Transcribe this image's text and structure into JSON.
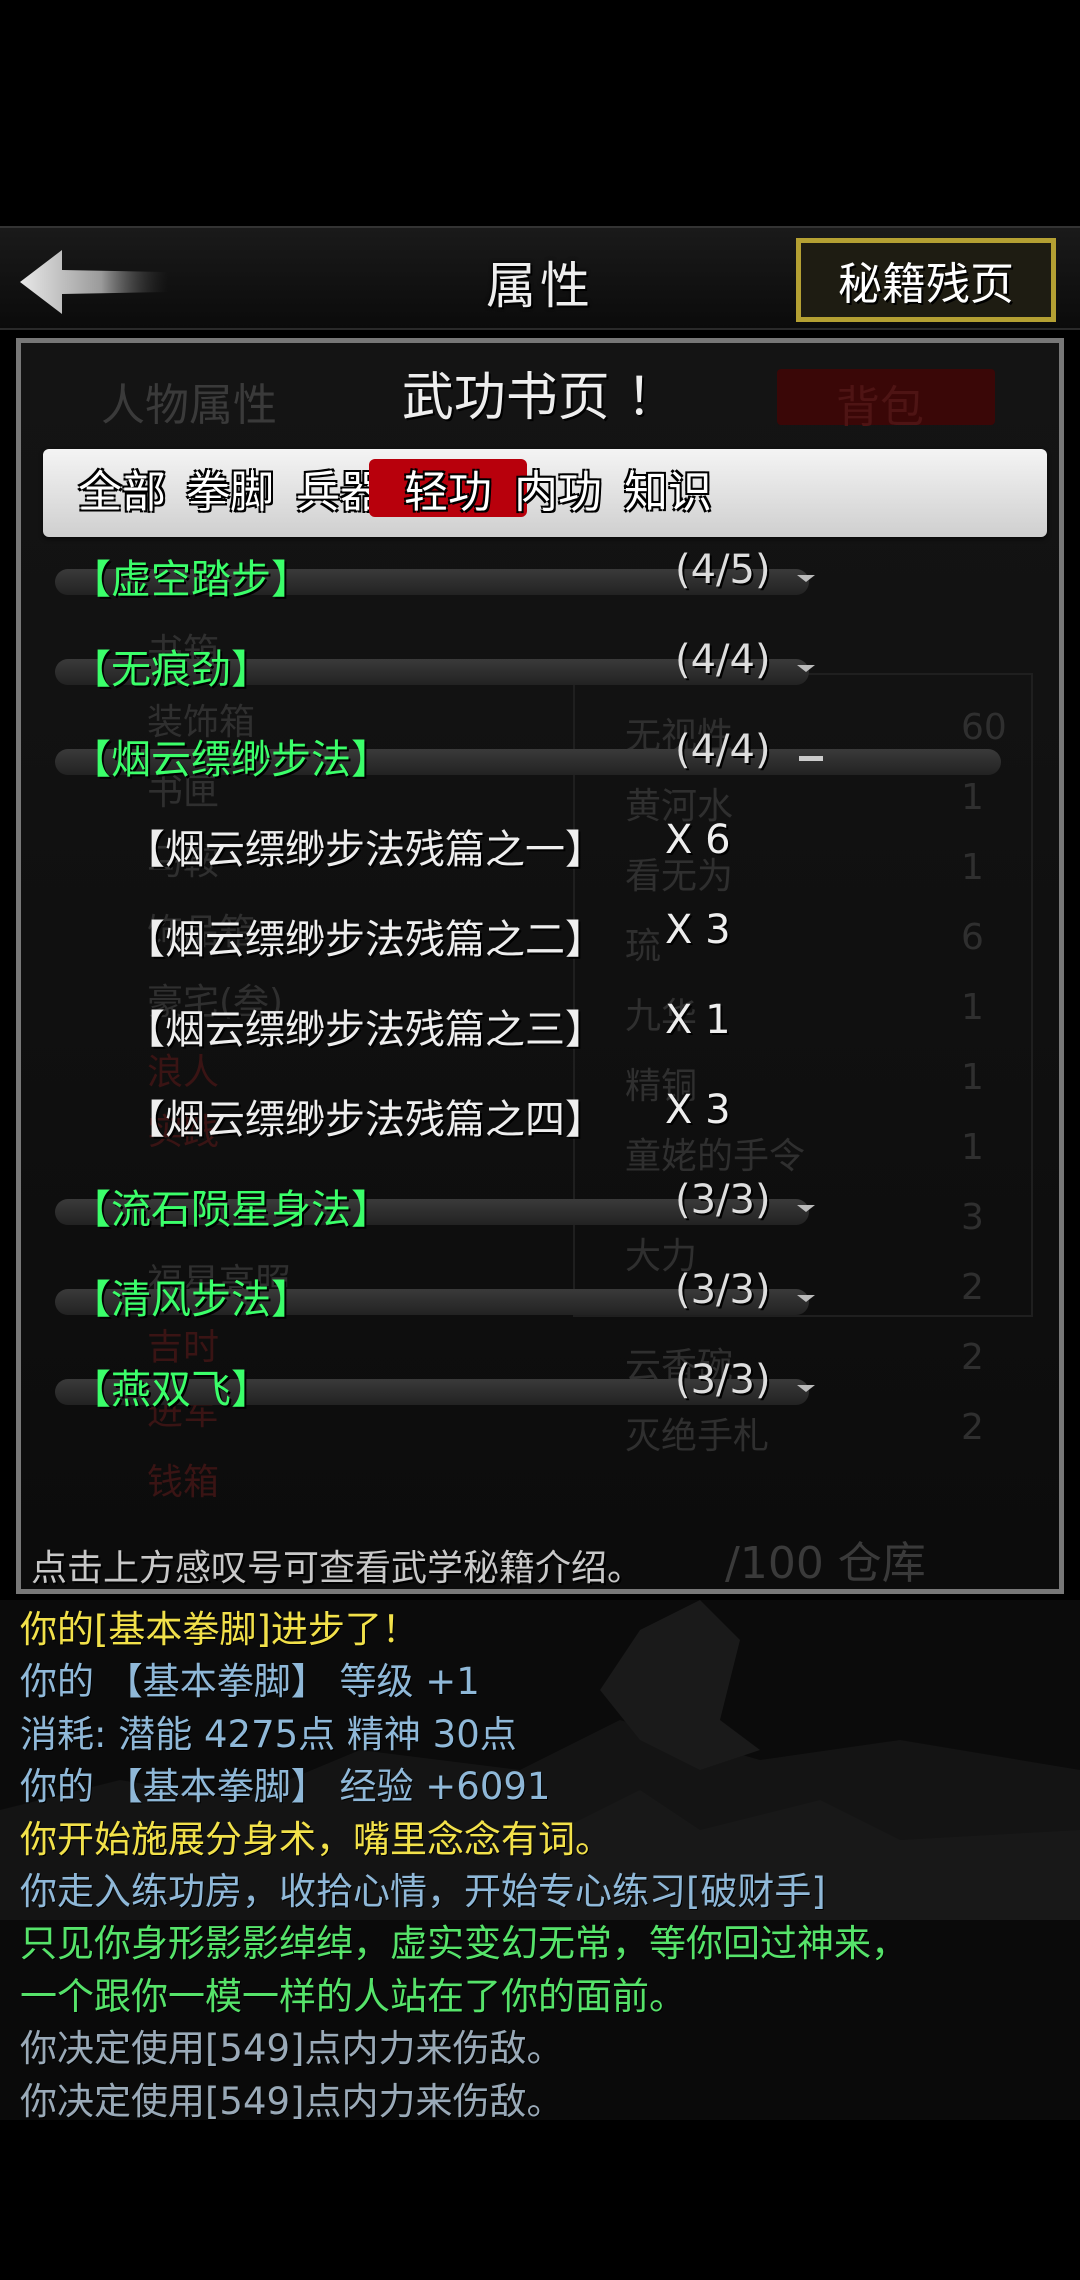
{
  "header": {
    "title": "属性",
    "secret_button": "秘籍残页"
  },
  "panel": {
    "title": "武功书页",
    "info_mark": "！",
    "tabs": [
      {
        "label": "全部"
      },
      {
        "label": "拳脚"
      },
      {
        "label": "兵器"
      },
      {
        "label": "轻功"
      },
      {
        "label": "内功"
      },
      {
        "label": "知识"
      }
    ],
    "active_tab": "轻功",
    "background_text": {
      "tab_left": "人物属性",
      "tab_right": "背包",
      "left_items": [
        "书箱",
        "装饰箱",
        "书匣",
        "马鞍",
        "饰品箱",
        "豪宅(叁)",
        "浪人",
        "实践",
        "福星高照",
        "吉时",
        "进军",
        "钱箱"
      ],
      "right_items": [
        "无视性",
        "黄河水",
        "看无为",
        "琉",
        "九华",
        "精铜",
        "童姥的手令",
        "大力",
        "云香碗",
        "灭绝手札"
      ],
      "right_counts": [
        "60",
        "1",
        "1",
        "6",
        "1",
        "1",
        "1",
        "3",
        "2",
        "2",
        "2"
      ],
      "storage": "/100 仓库"
    },
    "skills": [
      {
        "name": "【虚空踏步】",
        "count": "(4/5)",
        "expanded": false
      },
      {
        "name": "【无痕劲】",
        "count": "(4/4)",
        "expanded": false
      },
      {
        "name": "【烟云缥缈步法】",
        "count": "(4/4)",
        "expanded": true
      },
      {
        "name": "【流石陨星身法】",
        "count": "(3/3)",
        "expanded": false
      },
      {
        "name": "【清风步法】",
        "count": "(3/3)",
        "expanded": false
      },
      {
        "name": "【燕双飞】",
        "count": "(3/3)",
        "expanded": false
      }
    ],
    "pages": [
      {
        "name": "【烟云缥缈步法残篇之一】",
        "qty": "X 6"
      },
      {
        "name": "【烟云缥缈步法残篇之二】",
        "qty": "X 3"
      },
      {
        "name": "【烟云缥缈步法残篇之三】",
        "qty": "X 1"
      },
      {
        "name": "【烟云缥缈步法残篇之四】",
        "qty": "X 3"
      }
    ],
    "hint": "点击上方感叹号可查看武学秘籍介绍。"
  },
  "log": [
    {
      "text": "你的[基本拳脚]进步了！",
      "color": "#f2e14a"
    },
    {
      "text": "你的 【基本拳脚】 等级 +1",
      "color": "#8fb8d8"
    },
    {
      "text": "消耗: 潜能 4275点  精神 30点",
      "color": "#8fb8d8"
    },
    {
      "text": "你的 【基本拳脚】 经验 +6091",
      "color": "#8fb8d8"
    },
    {
      "text": "你开始施展分身术，嘴里念念有词。",
      "color": "#f2e14a"
    },
    {
      "text": "你走入练功房，收拾心情，开始专心练习[破财手]",
      "color": "#8fb8d8"
    },
    {
      "text": "只见你身形影影绰绰，虚实变幻无常，等你回过神来，",
      "color": "#56e36a"
    },
    {
      "text": "一个跟你一模一样的人站在了你的面前。",
      "color": "#56e36a"
    },
    {
      "text": "你决定使用[549]点内力来伤敌。",
      "color": "#9aaab8"
    },
    {
      "text": "你决定使用[549]点内力来伤敌。",
      "color": "#9aaab8"
    }
  ],
  "colors": {
    "accent_red": "#b8000c",
    "skill_green": "#3bff6a",
    "button_border": "#b4a033"
  },
  "icons": {
    "back": "back-arrow-icon",
    "collapsed": "chevron-down-icon",
    "expanded": "minus-icon"
  }
}
